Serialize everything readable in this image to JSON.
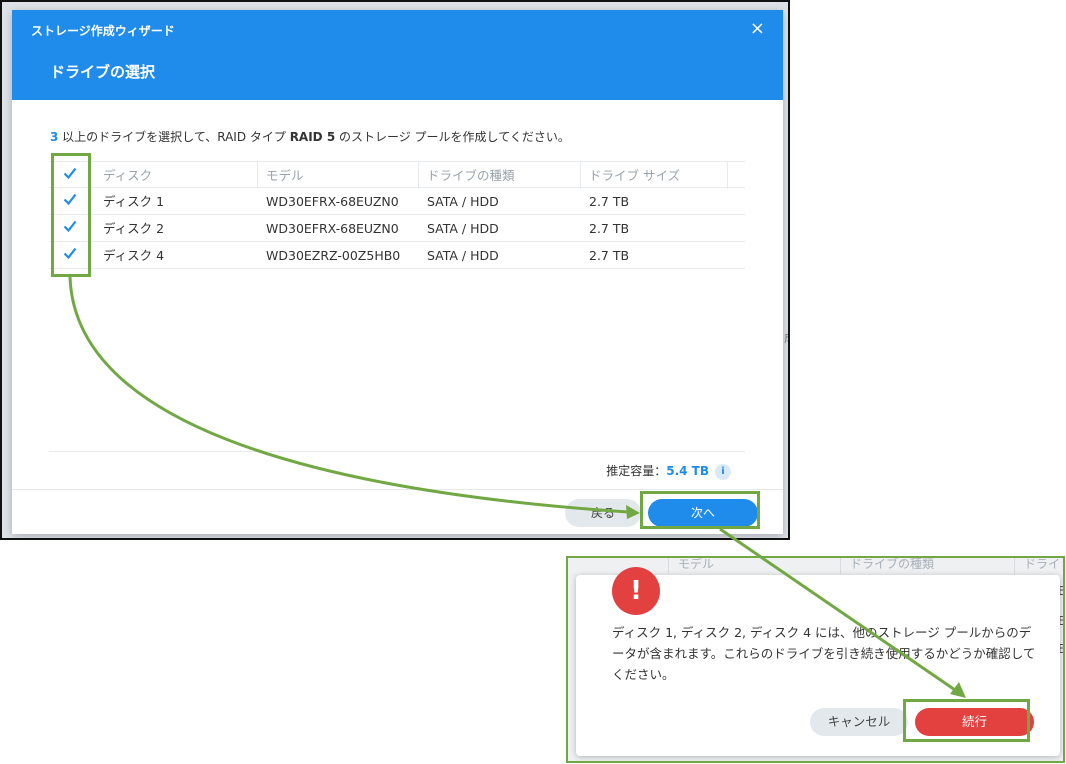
{
  "wizard": {
    "window_title": "ストレージ作成ウィザード",
    "close_symbol": "×",
    "step_title": "ドライブの選択",
    "instruction": {
      "count": "3",
      "text1": " 以上のドライブを選択して、RAID タイプ ",
      "raid": "RAID 5",
      "text2": " のストレージ プールを作成してください。"
    },
    "table": {
      "headers": [
        "ディスク",
        "モデル",
        "ドライブの種類",
        "ドライブ サイズ"
      ],
      "rows": [
        {
          "disk": "ディスク 1",
          "model": "WD30EFRX-68EUZN0",
          "type": "SATA / HDD",
          "size": "2.7 TB",
          "checked": true
        },
        {
          "disk": "ディスク 2",
          "model": "WD30EFRX-68EUZN0",
          "type": "SATA / HDD",
          "size": "2.7 TB",
          "checked": true
        },
        {
          "disk": "ディスク 4",
          "model": "WD30EZRZ-00Z5HB0",
          "type": "SATA / HDD",
          "size": "2.7 TB",
          "checked": true
        }
      ]
    },
    "capacity": {
      "label": "推定容量：",
      "value": "5.4 TB",
      "info": "i"
    },
    "back_label": "戻る",
    "next_label": "次へ",
    "peek_text": "成"
  },
  "confirm": {
    "alert_symbol": "!",
    "message": "ディスク 1, ディスク 2, ディスク 4 には、他のストレージ プールからのデータが含まれます。これらのドライブを引き続き使用するかどうか確認してください。",
    "cancel_label": "キャンセル",
    "continue_label": "続行",
    "bg_headers": [
      "モデル",
      "ドライブの種類",
      "ドライ"
    ],
    "bg_side": [
      "B",
      "B",
      "B"
    ]
  },
  "colors": {
    "accent": "#1f8bea",
    "danger": "#e34040",
    "highlight": "#72a844"
  }
}
